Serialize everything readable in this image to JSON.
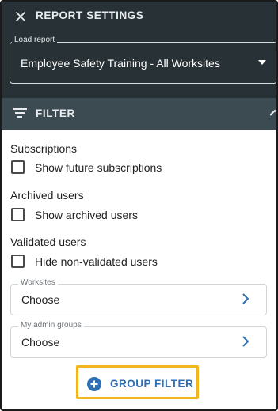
{
  "header": {
    "title": "REPORT SETTINGS",
    "close_icon": "close-icon",
    "background": "#283236"
  },
  "load_report": {
    "label": "Load report",
    "value": "Employee Safety Training - All Worksites",
    "dropdown_icon": "caret-down-icon"
  },
  "filter": {
    "label": "FILTER",
    "icon": "filter-icon",
    "collapse_icon": "chevron-up-icon",
    "background": "#3c4a52"
  },
  "sections": [
    {
      "title": "Subscriptions",
      "option": "Show future subscriptions",
      "checked": false
    },
    {
      "title": "Archived users",
      "option": "Show archived users",
      "checked": false
    },
    {
      "title": "Validated users",
      "option": "Hide non-validated users",
      "checked": false
    }
  ],
  "selects": [
    {
      "label": "Worksites",
      "value": "Choose",
      "icon": "chevron-right-icon"
    },
    {
      "label": "My admin groups",
      "value": "Choose",
      "icon": "chevron-right-icon"
    }
  ],
  "group_filter": {
    "label": "GROUP FILTER",
    "icon": "plus-circle-icon",
    "accent": "#2f6fb3",
    "highlight": "#f2b51b"
  }
}
